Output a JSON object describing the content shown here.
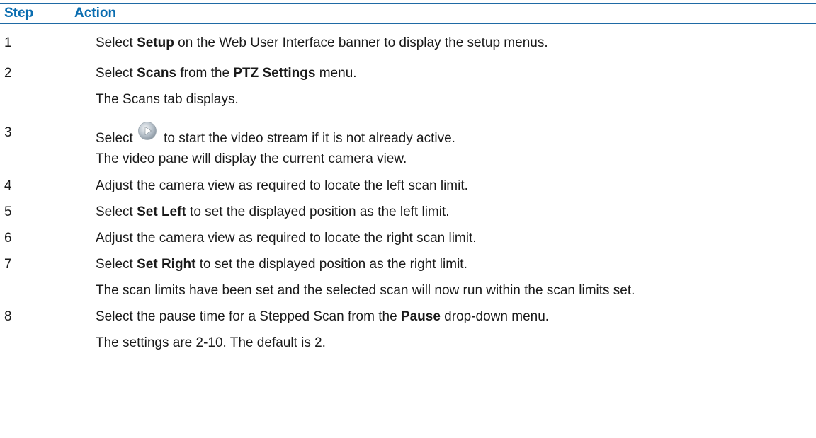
{
  "header": {
    "step_label": "Step",
    "action_label": "Action"
  },
  "steps": [
    {
      "num": "1",
      "lines": [
        {
          "parts": [
            "Select ",
            "Setup",
            " on the Web User Interface banner to display the setup menus."
          ]
        }
      ]
    },
    {
      "num": "2",
      "lines": [
        {
          "parts": [
            "Select ",
            "Scans",
            " from the ",
            "PTZ Settings",
            " menu."
          ]
        },
        {
          "text": "The Scans tab displays."
        }
      ]
    },
    {
      "num": "3",
      "lines": [
        {
          "before": "Select",
          "icon": "play-icon",
          "after": " to start the video stream if it is not already active."
        },
        {
          "text": "The video pane will display the current camera view."
        }
      ]
    },
    {
      "num": "4",
      "lines": [
        {
          "text": "Adjust the camera view as required to locate the left scan limit."
        }
      ]
    },
    {
      "num": "5",
      "lines": [
        {
          "parts": [
            "Select ",
            "Set Left",
            " to set the displayed position as the left limit."
          ]
        }
      ]
    },
    {
      "num": "6",
      "lines": [
        {
          "text": "Adjust the camera view as required to locate the right scan limit."
        }
      ]
    },
    {
      "num": "7",
      "lines": [
        {
          "parts": [
            "Select ",
            "Set Right",
            " to set the displayed position as the right limit."
          ]
        },
        {
          "text": "The scan limits have been set and the selected scan will now run within the scan limits set."
        }
      ]
    },
    {
      "num": "8",
      "lines": [
        {
          "parts": [
            "Select the pause time for a Stepped Scan from the ",
            "Pause",
            " drop-down menu."
          ]
        },
        {
          "text": "The settings are 2-10. The default is 2."
        }
      ]
    }
  ],
  "colors": {
    "header_text": "#0a6db0",
    "header_rule": "#1f6aa5",
    "body_text": "#1a1a1a"
  }
}
